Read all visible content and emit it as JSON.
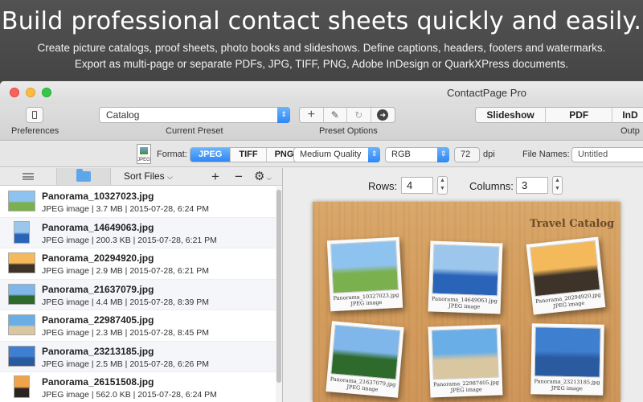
{
  "banner": {
    "headline": "Build professional contact sheets quickly and easily.",
    "line1": "Create picture catalogs, proof sheets, photo books and slideshows. Define captions, headers, footers and watermarks.",
    "line2": "Export as multi-page or separate PDFs, JPG, TIFF, PNG, Adobe InDesign or QuarkXPress documents."
  },
  "window": {
    "title": "ContactPage Pro"
  },
  "toolbar": {
    "preferences_label": "Preferences",
    "preset_value": "Catalog",
    "preset_label": "Current Preset",
    "preset_options_label": "Preset Options",
    "output_buttons": [
      "Slideshow",
      "PDF",
      "InD"
    ],
    "output_label": "Outp"
  },
  "formatbar": {
    "file_icon_text": "JPEG",
    "format_label": "Format:",
    "formats": [
      "JPEG",
      "TIFF",
      "PNG"
    ],
    "selected_format": "JPEG",
    "quality": "Medium Quality",
    "color": "RGB",
    "dpi_value": "72",
    "dpi_label": "dpi",
    "file_names_label": "File Names:",
    "file_names_value": "Untitled"
  },
  "sidebar": {
    "sort_label": "Sort Files",
    "files": [
      {
        "name": "Panorama_10327023.jpg",
        "meta": "JPEG image | 3.7 MB | 2015-07-28, 6:24 PM",
        "colors": [
          "#8fc3ef",
          "#7bb04e"
        ]
      },
      {
        "name": "Panorama_14649063.jpg",
        "meta": "JPEG image | 200.3 KB | 2015-07-28, 6:21 PM",
        "colors": [
          "#9cc6ec",
          "#2a64b8"
        ]
      },
      {
        "name": "Panorama_20294920.jpg",
        "meta": "JPEG image | 2.9 MB | 2015-07-28, 6:21 PM",
        "colors": [
          "#f3b95a",
          "#3d3328"
        ]
      },
      {
        "name": "Panorama_21637079.jpg",
        "meta": "JPEG image | 4.4 MB | 2015-07-28, 8:39 PM",
        "colors": [
          "#7fb7ea",
          "#2d6a2c"
        ]
      },
      {
        "name": "Panorama_22987405.jpg",
        "meta": "JPEG image | 2.3 MB | 2015-07-28, 8:45 PM",
        "colors": [
          "#6aaee8",
          "#d8c7a0"
        ]
      },
      {
        "name": "Panorama_23213185.jpg",
        "meta": "JPEG image | 2.5 MB | 2015-07-28, 6:26 PM",
        "colors": [
          "#3f7fd0",
          "#2a5aa0"
        ]
      },
      {
        "name": "Panorama_26151508.jpg",
        "meta": "JPEG image | 562.0 KB | 2015-07-28, 6:24 PM",
        "colors": [
          "#f0a34a",
          "#2a2520"
        ]
      }
    ]
  },
  "layout_controls": {
    "rows_label": "Rows:",
    "rows_value": "4",
    "columns_label": "Columns:",
    "columns_value": "3"
  },
  "catalog": {
    "title": "Travel Catalog",
    "photos": [
      {
        "caption": "Panorama_10327023.jpg",
        "type": "JPEG image",
        "colors": [
          "#8fc3ef",
          "#7bb04e"
        ]
      },
      {
        "caption": "Panorama_14649063.jpg",
        "type": "JPEG image",
        "colors": [
          "#9cc6ec",
          "#2a64b8"
        ]
      },
      {
        "caption": "Panorama_20294920.jpg",
        "type": "JPEG image",
        "colors": [
          "#f3b95a",
          "#3d3328"
        ]
      },
      {
        "caption": "Panorama_21637079.jpg",
        "type": "JPEG image",
        "colors": [
          "#7fb7ea",
          "#2d6a2c"
        ]
      },
      {
        "caption": "Panorama_22987405.jpg",
        "type": "JPEG image",
        "colors": [
          "#6aaee8",
          "#d8c7a0"
        ]
      },
      {
        "caption": "Panorama_23213185.jpg",
        "type": "JPEG image",
        "colors": [
          "#3f7fd0",
          "#2a5aa0"
        ]
      }
    ]
  },
  "colors": {
    "accent": "#2d87f5",
    "banner_bg": "#4a4a4a"
  }
}
